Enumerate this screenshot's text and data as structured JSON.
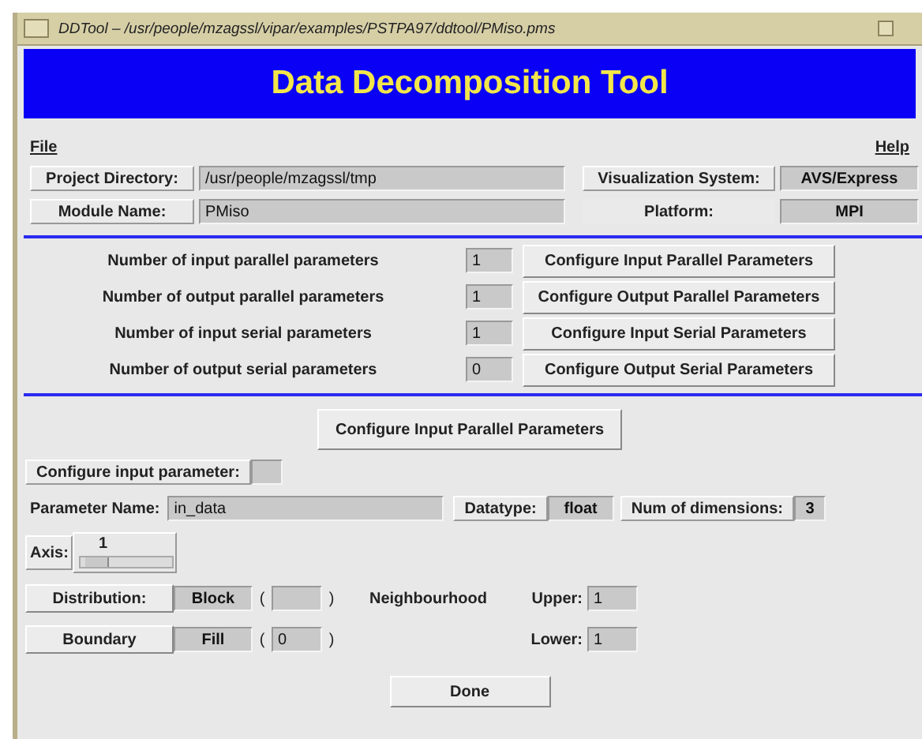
{
  "window": {
    "title": "DDTool – /usr/people/mzagssl/vipar/examples/PSTPA97/ddtool/PMiso.pms"
  },
  "header": {
    "title": "Data Decomposition Tool"
  },
  "menu": [
    "File",
    "Help"
  ],
  "project": {
    "directory_label": "Project Directory:",
    "directory": "/usr/people/mzagssl/tmp",
    "system_label": "Visualization System:",
    "system": "AVS/Express",
    "module_label": "Module Name:",
    "module": "PMiso",
    "platform_label": "Platform:",
    "platform": "MPI"
  },
  "parameter_counts": [
    {
      "label": "Number of input parallel parameters",
      "value": "1",
      "button": "Configure Input Parallel Parameters"
    },
    {
      "label": "Number of output parallel parameters",
      "value": "1",
      "button": "Configure Output Parallel Parameters"
    },
    {
      "label": "Number of input serial parameters",
      "value": "1",
      "button": "Configure Input Serial Parameters"
    },
    {
      "label": "Number of output serial parameters",
      "value": "0",
      "button": "Configure Output Serial Parameters"
    }
  ],
  "configure": {
    "section_button": "Configure Input Parallel Parameters",
    "parameter_label": "Configure input parameter:",
    "name_label": "Parameter Name:",
    "name": "in_data",
    "datatype_label": "Datatype:",
    "datatype": "float",
    "dimensions_label": "Num of dimensions:",
    "dimensions": "3",
    "axis_label": "Axis:",
    "axis": {
      "value": "1",
      "level": 0.05
    },
    "distribution_label": "Distribution:",
    "distribution": "Block",
    "distribution_open": "(",
    "distribution_close": ")",
    "neighbourhood_label": "Neighbourhood",
    "upper_label": "Upper:",
    "upper": "1",
    "boundary_label": "Boundary",
    "boundary": "Fill",
    "boundary_open": "(",
    "boundary_value": "0",
    "boundary_close": ")",
    "lower_label": "Lower:",
    "lower": "1"
  },
  "buttons": [
    "Done"
  ]
}
